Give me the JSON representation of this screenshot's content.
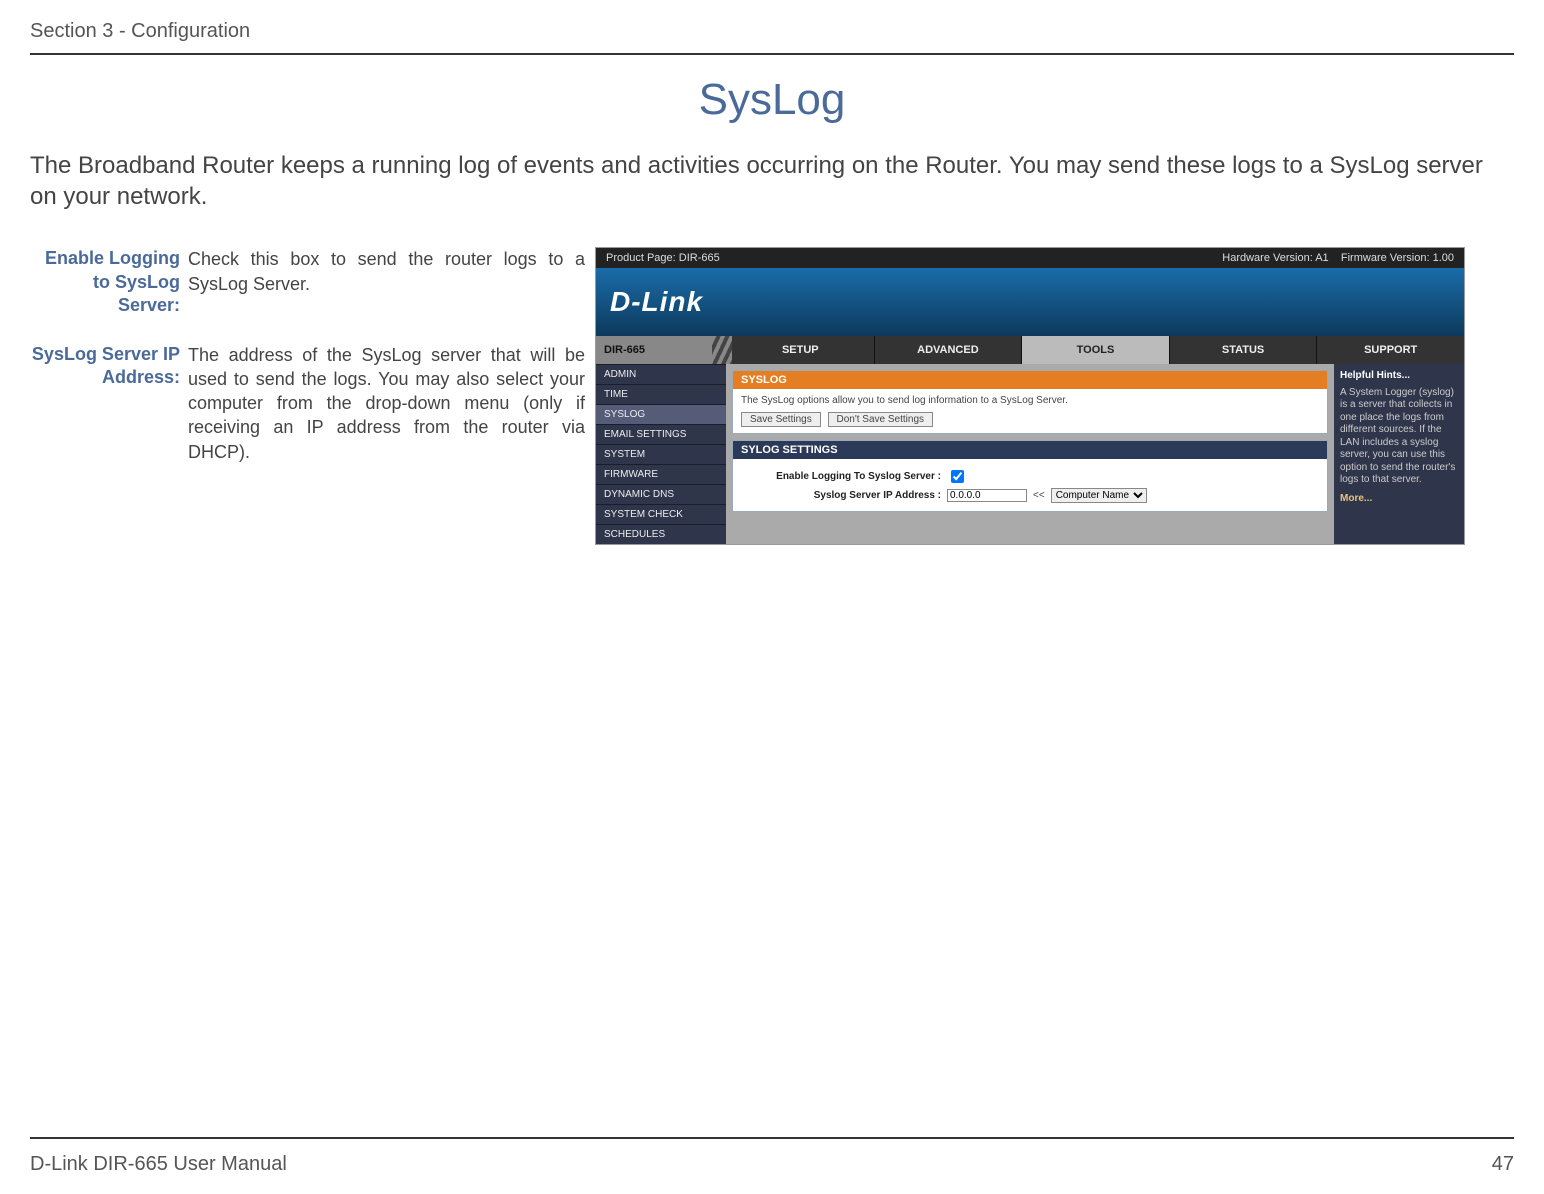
{
  "header": {
    "section": "Section 3 - Configuration"
  },
  "page": {
    "title": "SysLog",
    "intro": "The Broadband Router keeps a running log of events and activities occurring on the Router. You may send these logs to a SysLog server on your network."
  },
  "fields": [
    {
      "label": "Enable Logging to SysLog Server:",
      "desc": "Check this box to send the router logs to a SysLog Server."
    },
    {
      "label": "SysLog Server IP Address:",
      "desc": "The address of the SysLog server that will be used to send the logs. You may also select your computer from the drop-down menu (only if receiving an IP address from the router via DHCP)."
    }
  ],
  "router": {
    "topbar": {
      "product": "Product Page: DIR-665",
      "hw": "Hardware Version: A1",
      "fw": "Firmware Version: 1.00"
    },
    "logo": "D-Link",
    "model": "DIR-665",
    "tabs": [
      "SETUP",
      "ADVANCED",
      "TOOLS",
      "STATUS",
      "SUPPORT"
    ],
    "active_tab": 2,
    "sidebar": [
      "ADMIN",
      "TIME",
      "SYSLOG",
      "EMAIL SETTINGS",
      "SYSTEM",
      "FIRMWARE",
      "DYNAMIC DNS",
      "SYSTEM CHECK",
      "SCHEDULES"
    ],
    "active_side": 2,
    "panel1": {
      "title": "SYSLOG",
      "desc": "The SysLog options allow you to send log information to a SysLog Server.",
      "buttons": [
        "Save Settings",
        "Don't Save Settings"
      ]
    },
    "panel2": {
      "title": "SYLOG SETTINGS",
      "rows": {
        "enable_label": "Enable Logging To Syslog Server :",
        "ip_label": "Syslog Server IP Address :",
        "ip_value": "0.0.0.0",
        "arrows": "<<",
        "select": "Computer Name"
      }
    },
    "hints": {
      "head": "Helpful Hints...",
      "body": "A System Logger (syslog) is a server that collects in one place the logs from different sources. If the LAN includes a syslog server, you can use this option to send the router's logs to that server.",
      "more": "More..."
    }
  },
  "footer": {
    "left": "D-Link DIR-665 User Manual",
    "right": "47"
  }
}
